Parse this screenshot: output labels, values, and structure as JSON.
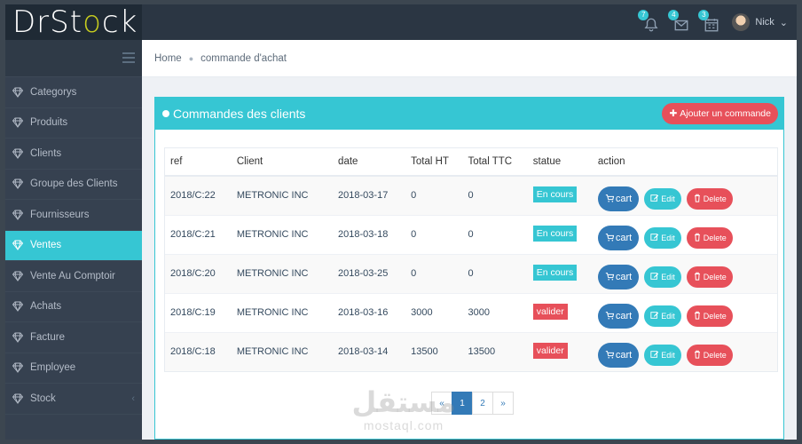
{
  "app": {
    "logo_part1": "Dr",
    "logo_part2": "St",
    "logo_accent": "o",
    "logo_part3": "ck"
  },
  "header": {
    "notifications": [
      {
        "icon": "bell-icon",
        "count": "7"
      },
      {
        "icon": "envelope-icon",
        "count": "4"
      },
      {
        "icon": "calendar-icon",
        "count": "3"
      }
    ],
    "user_name": "Nick"
  },
  "sidebar": {
    "items": [
      {
        "label": "Categorys"
      },
      {
        "label": "Produits"
      },
      {
        "label": "Clients"
      },
      {
        "label": "Groupe des Clients"
      },
      {
        "label": "Fournisseurs"
      },
      {
        "label": "Ventes",
        "active": true
      },
      {
        "label": "Vente Au Comptoir"
      },
      {
        "label": "Achats"
      },
      {
        "label": "Facture"
      },
      {
        "label": "Employee"
      },
      {
        "label": "Stock",
        "has_arrow": true
      }
    ]
  },
  "breadcrumb": {
    "home": "Home",
    "current": "commande d'achat"
  },
  "portlet": {
    "title": "Commandes des clients",
    "add_button": "Ajouter un commande"
  },
  "table": {
    "headers": [
      "ref",
      "Client",
      "date",
      "Total HT",
      "Total TTC",
      "statue",
      "action"
    ],
    "rows": [
      {
        "ref": "2018/C:22",
        "client": "METRONIC INC",
        "date": "2018-03-17",
        "ht": "0",
        "ttc": "0",
        "status": "En cours",
        "status_color": "cyan"
      },
      {
        "ref": "2018/C:21",
        "client": "METRONIC INC",
        "date": "2018-03-18",
        "ht": "0",
        "ttc": "0",
        "status": "En cours",
        "status_color": "cyan"
      },
      {
        "ref": "2018/C:20",
        "client": "METRONIC INC",
        "date": "2018-03-25",
        "ht": "0",
        "ttc": "0",
        "status": "En cours",
        "status_color": "cyan"
      },
      {
        "ref": "2018/C:19",
        "client": "METRONIC INC",
        "date": "2018-03-16",
        "ht": "3000",
        "ttc": "3000",
        "status": "valider",
        "status_color": "red"
      },
      {
        "ref": "2018/C:18",
        "client": "METRONIC INC",
        "date": "2018-03-14",
        "ht": "13500",
        "ttc": "13500",
        "status": "valider",
        "status_color": "red"
      }
    ],
    "actions": {
      "cart": "cart",
      "edit": "Edit",
      "delete": "Delete"
    }
  },
  "pagination": {
    "prev": "«",
    "pages": [
      "1",
      "2"
    ],
    "active": "1",
    "next": "»"
  },
  "watermark": {
    "arabic": "مستقل",
    "latin": "mostaql.com"
  },
  "colors": {
    "primary": "#36c6d3",
    "danger": "#e7505a",
    "blue": "#337ab7",
    "sidebar": "#364150",
    "header": "#2b3643"
  }
}
